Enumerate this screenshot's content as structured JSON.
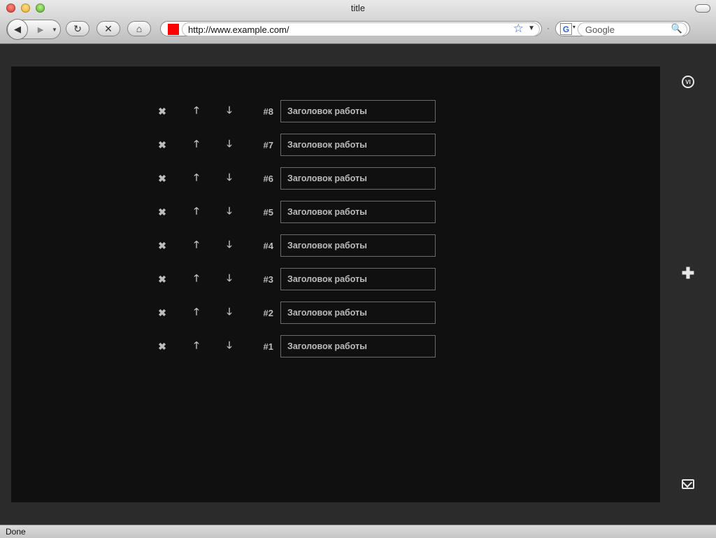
{
  "window": {
    "title": "title"
  },
  "toolbar": {
    "back_icon": "◀",
    "forward_icon": "▶",
    "reload_icon": "↻",
    "stop_icon": "✕",
    "home_icon": "⌂"
  },
  "address_bar": {
    "url": "http://www.example.com/"
  },
  "search_bar": {
    "engine_letter": "G",
    "placeholder": "Google"
  },
  "works": [
    {
      "number": "#8",
      "title": "Заголовок работы"
    },
    {
      "number": "#7",
      "title": "Заголовок работы"
    },
    {
      "number": "#6",
      "title": "Заголовок работы"
    },
    {
      "number": "#5",
      "title": "Заголовок работы"
    },
    {
      "number": "#4",
      "title": "Заголовок работы"
    },
    {
      "number": "#3",
      "title": "Заголовок работы"
    },
    {
      "number": "#2",
      "title": "Заголовок работы"
    },
    {
      "number": "#1",
      "title": "Заголовок работы"
    }
  ],
  "row_controls": {
    "delete": "✖",
    "up": "🡑",
    "down": "🡓"
  },
  "sidebar": {
    "vi_label": "VI",
    "add_symbol": "✚"
  },
  "status_bar": {
    "text": "Done"
  },
  "colors": {
    "panel_bg": "#101010",
    "page_bg": "#2b2b2b",
    "text": "#bdbdbd",
    "favicon": "#ff0000"
  }
}
